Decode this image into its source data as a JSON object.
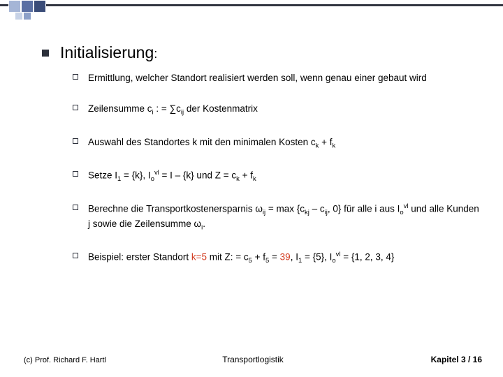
{
  "heading": "Initialisierung",
  "heading_colon": ":",
  "items": [
    {
      "html": "Ermittlung, welcher Standort realisiert werden soll, wenn genau einer gebaut wird"
    },
    {
      "html": "Zeilensumme c<span class=\"sub\">i</span> : = ∑c<span class=\"sub\">ij</span> der Kostenmatrix"
    },
    {
      "html": "Auswahl des Standortes k mit den minimalen Kosten c<span class=\"sub\">k</span> + f<span class=\"sub\">k</span>"
    },
    {
      "html": "Setze I<span class=\"sub\">1</span> = {k}, I<span class=\"sub\">o</span><span class=\"sup\">vl</span> = I – {k} und Z = c<span class=\"sub\">k</span> + f<span class=\"sub\">k</span>"
    },
    {
      "html": "Berechne die Transportkostenersparnis ω<span class=\"sub\">ij</span> = max {c<span class=\"sub\">kj</span> – c<span class=\"sub\">ij</span>, 0} für alle i aus I<span class=\"sub\">o</span><span class=\"sup\">vl</span> und alle Kunden j sowie die Zeilensumme ω<span class=\"sub\">i</span>."
    },
    {
      "html": "Beispiel: erster Standort <span class=\"hl\">k=5</span> mit Z: = c<span class=\"sub\">5</span> + f<span class=\"sub\">5</span> = <span class=\"hl\">39</span>, I<span class=\"sub\">1</span> = {5}, I<span class=\"sub\">o</span><span class=\"sup\">vl</span> = {1, 2, 3, 4}"
    }
  ],
  "footer": {
    "left": "(c) Prof. Richard F. Hartl",
    "center": "Transportlogistik",
    "right_prefix": "Kapitel 3 /  ",
    "page": "16"
  }
}
